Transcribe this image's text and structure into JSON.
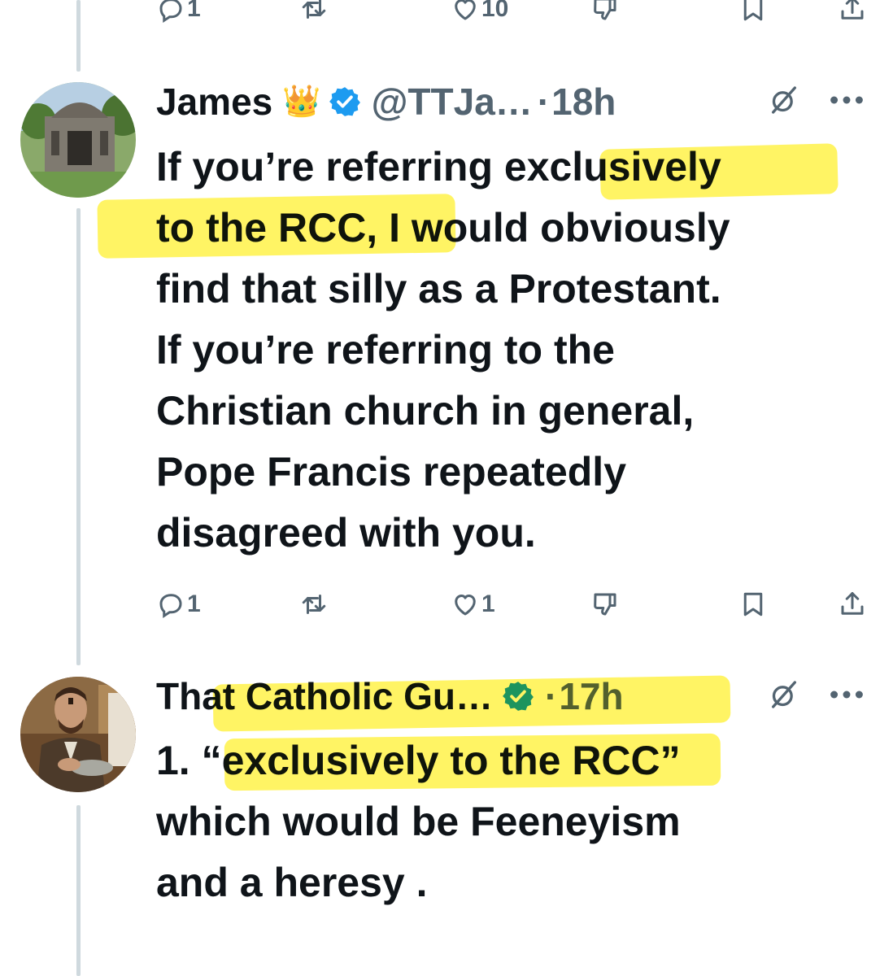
{
  "top_actions": {
    "reply_count": "1",
    "like_count": "10"
  },
  "tweet1": {
    "name": "James",
    "badge_emoji": "👑",
    "handle": "@TTJa…",
    "dot": "·",
    "time": "18h",
    "text_lines": [
      "If you’re referring exclusively",
      "to the RCC, I would obviously",
      "find that silly as a Protestant.",
      "If you’re referring to the",
      "Christian church in general,",
      "Pope Francis repeatedly",
      "disagreed with you."
    ],
    "reply_count": "1",
    "like_count": "1"
  },
  "tweet2": {
    "name": "That Catholic Gu…",
    "dot": "·",
    "time": "17h",
    "text_lines": [
      "1. “exclusively to the RCC”",
      "which would be Feeneyism",
      "and a heresy ."
    ]
  },
  "colors": {
    "highlight": "#fff028",
    "verified": "#1d9bf0",
    "muted": "#536471",
    "text": "#0f1419",
    "thread_line": "#cfd9de"
  },
  "icons": [
    "reply-icon",
    "retweet-icon",
    "like-icon",
    "dislike-icon",
    "bookmark-icon",
    "share-icon",
    "grok-icon",
    "more-icon",
    "verified-icon"
  ]
}
